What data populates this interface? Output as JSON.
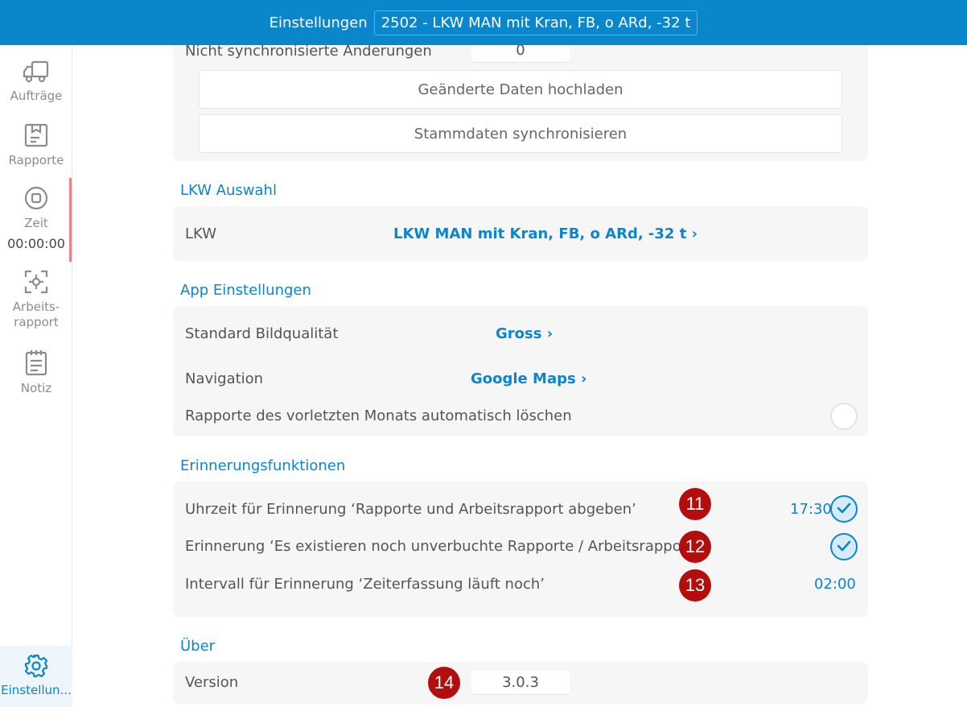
{
  "header": {
    "title": "Einstellungen",
    "vehicle": "2502 - LKW MAN mit Kran, FB, o ARd, -32 t"
  },
  "sidebar": {
    "items": [
      {
        "label": "Aufträge",
        "icon": "truck-icon"
      },
      {
        "label": "Rapporte",
        "icon": "report-icon"
      },
      {
        "label": "Zeit",
        "icon": "stop-timer-icon",
        "timer": "00:00:00"
      },
      {
        "label_line1": "Arbeits-",
        "label_line2": "rapport",
        "icon": "scan-target-icon"
      },
      {
        "label": "Notiz",
        "icon": "notepad-icon"
      }
    ],
    "settings": {
      "label": "Einstellun...",
      "icon": "gear-icon"
    }
  },
  "sync": {
    "unsynced_label": "Nicht synchronisierte Änderungen",
    "unsynced_count": "0",
    "upload_button": "Geänderte Daten hochladen",
    "sync_button": "Stammdaten synchronisieren"
  },
  "truck": {
    "section_title": "LKW Auswahl",
    "label": "LKW",
    "value": "LKW MAN mit Kran, FB, o ARd, -32 t ›"
  },
  "app_settings": {
    "section_title": "App Einstellungen",
    "quality_label": "Standard Bildqualität",
    "quality_value": "Gross ›",
    "navigation_label": "Navigation",
    "navigation_value": "Google Maps ›",
    "autodelete_label": "Rapporte des vorletzten Monats automatisch löschen",
    "autodelete_enabled": false
  },
  "reminders": {
    "section_title": "Erinnerungsfunktionen",
    "items": [
      {
        "label": "Uhrzeit für Erinnerung ‘Rapporte und Arbeitsrapport abgeben’",
        "value": "17:30",
        "checked": true,
        "badge": "11"
      },
      {
        "label": "Erinnerung ‘Es existieren noch unverbuchte Rapporte / Arbeitsrapporte’",
        "checked": true,
        "badge": "12"
      },
      {
        "label": "Intervall für Erinnerung ‘Zeiterfassung läuft noch’",
        "value": "02:00",
        "badge": "13"
      }
    ]
  },
  "about": {
    "section_title": "Über",
    "version_label": "Version",
    "version_value": "3.0.3",
    "badge": "14"
  },
  "colors": {
    "accent": "#0a86cc",
    "badge": "#b30d0d",
    "timer_indicator": "#f08080"
  }
}
